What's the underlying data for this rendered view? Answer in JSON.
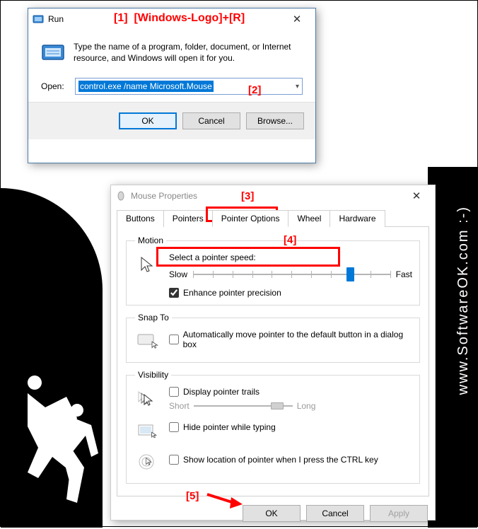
{
  "annotations": {
    "a1": "[1]",
    "a1_text": "[Windows-Logo]+[R]",
    "a2": "[2]",
    "a3": "[3]",
    "a4": "[4]",
    "a5": "[5]"
  },
  "watermark": "www.SoftwareOK.com :-)",
  "run": {
    "title": "Run",
    "description": "Type the name of a program, folder, document, or Internet resource, and Windows will open it for you.",
    "open_label": "Open:",
    "open_value": "control.exe /name Microsoft.Mouse",
    "ok": "OK",
    "cancel": "Cancel",
    "browse": "Browse..."
  },
  "mouse": {
    "title": "Mouse Properties",
    "tabs": [
      "Buttons",
      "Pointers",
      "Pointer Options",
      "Wheel",
      "Hardware"
    ],
    "active_tab_index": 2,
    "motion": {
      "legend": "Motion",
      "select_label": "Select a pointer speed:",
      "slow": "Slow",
      "fast": "Fast",
      "enhance": "Enhance pointer precision",
      "enhance_checked": true
    },
    "snapto": {
      "legend": "Snap To",
      "auto_move": "Automatically move pointer to the default button in a dialog box",
      "auto_move_checked": false
    },
    "visibility": {
      "legend": "Visibility",
      "trails": "Display pointer trails",
      "trails_checked": false,
      "short": "Short",
      "long": "Long",
      "hide_typing": "Hide pointer while typing",
      "hide_typing_checked": false,
      "ctrl_locate": "Show location of pointer when I press the CTRL key",
      "ctrl_locate_checked": false
    },
    "ok": "OK",
    "cancel": "Cancel",
    "apply": "Apply"
  }
}
